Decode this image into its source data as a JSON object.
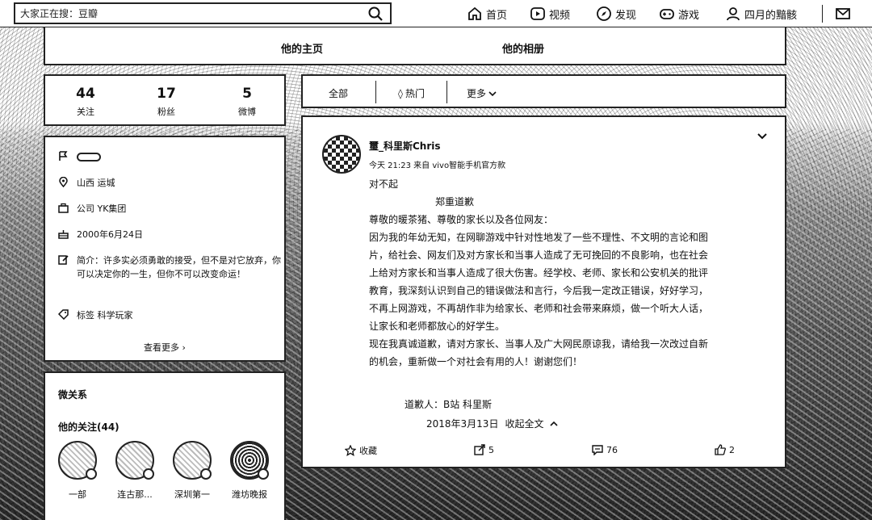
{
  "search": {
    "placeholder": "大家正在搜：豆瓣"
  },
  "nav": {
    "home": "首页",
    "video": "视频",
    "discover": "发现",
    "game": "游戏",
    "user": "四月的黯骸"
  },
  "tabs": [
    "他的主页",
    "他的相册"
  ],
  "stats": [
    {
      "value": "44",
      "label": "关注"
    },
    {
      "value": "17",
      "label": "粉丝"
    },
    {
      "value": "5",
      "label": "微博"
    }
  ],
  "info": {
    "location": "山西 运城",
    "company": "公司 YK集团",
    "birthday": "2000年6月24日",
    "bio": "简介：许多实必须勇敢的接受，但不是对它放弃，你可以决定你的一生，但你不可以改变命运！",
    "tags": "标签 科学玩家",
    "more": "查看更多"
  },
  "relations": {
    "title": "微关系",
    "following_title": "他的关注(44)",
    "following": [
      {
        "name": "一部"
      },
      {
        "name": "连古那..."
      },
      {
        "name": "深圳第一"
      },
      {
        "name": "潍坊晚报"
      }
    ]
  },
  "filter": {
    "all": "全部",
    "hot": "热门",
    "more": "更多"
  },
  "post": {
    "author": "璽_科里斯Chris",
    "meta": "今天 21:23 来自 vivo智能手机官方款",
    "lines": [
      "对不起",
      "郑重道歉",
      "尊敬的暖茶猪、尊敬的家长以及各位网友：",
      "因为我的年幼无知，在网聊游戏中针对性地发了一些不理性、不文明的言论和图",
      "片，给社会、网友们及对方家长和当事人造成了无可挽回的不良影响，也在社会",
      "上给对方家长和当事人造成了很大伤害。经学校、老师、家长和公安机关的批评",
      "教育，我深刻认识到自己的错误做法和言行，今后我一定改正错误，好好学习，",
      "不再上网游戏，不再胡作非为给家长、老师和社会带来麻烦，做一个听大人话，",
      "让家长和老师都放心的好学生。",
      "现在我真诚道歉，请对方家长、当事人及广大网民原谅我，请给我一次改过自新",
      "的机会，重新做一个对社会有用的人！谢谢您们！"
    ],
    "signature": "道歉人：B站 科里斯",
    "date": "2018年3月13日",
    "collapse": "收起全文",
    "actions": {
      "favorite": "收藏",
      "repost": "5",
      "comment": "76",
      "like": "2"
    }
  }
}
